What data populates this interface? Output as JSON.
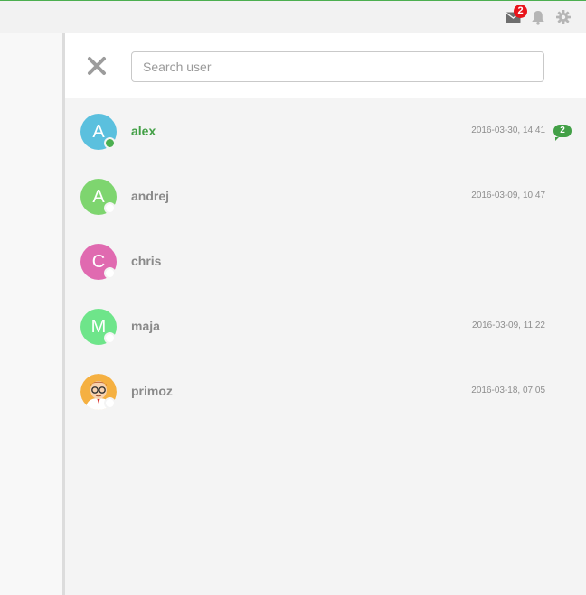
{
  "topbar": {
    "mail_badge": "2",
    "icons": [
      "mail-icon",
      "bell-icon",
      "gear-icon"
    ],
    "accent": "#4caf50"
  },
  "search": {
    "placeholder": "Search user",
    "value": ""
  },
  "users": [
    {
      "initial": "A",
      "name": "alex",
      "time": "2016-03-30, 14:41",
      "status": "online",
      "color": "#5bc0de",
      "active": true,
      "unread": "2"
    },
    {
      "initial": "A",
      "name": "andrej",
      "time": "2016-03-09, 10:47",
      "status": "offline",
      "color": "#7ed56f",
      "active": false,
      "unread": null
    },
    {
      "initial": "C",
      "name": "chris",
      "time": "",
      "status": "offline",
      "color": "#e06ab0",
      "active": false,
      "unread": null
    },
    {
      "initial": "M",
      "name": "maja",
      "time": "2016-03-09, 11:22",
      "status": "offline",
      "color": "#6ee58a",
      "active": false,
      "unread": null
    },
    {
      "initial": "",
      "name": "primoz",
      "time": "2016-03-18, 07:05",
      "status": "offline",
      "color": "#f5b041",
      "active": false,
      "unread": null,
      "photo": true
    }
  ]
}
